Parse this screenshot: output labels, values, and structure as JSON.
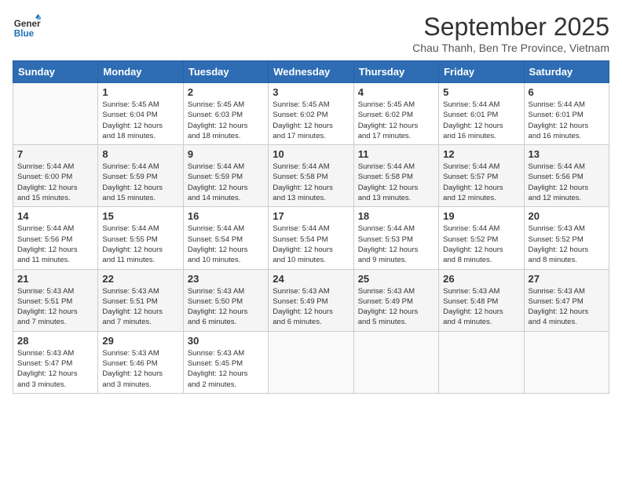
{
  "logo": {
    "general": "General",
    "blue": "Blue"
  },
  "title": "September 2025",
  "location": "Chau Thanh, Ben Tre Province, Vietnam",
  "headers": [
    "Sunday",
    "Monday",
    "Tuesday",
    "Wednesday",
    "Thursday",
    "Friday",
    "Saturday"
  ],
  "weeks": [
    [
      {
        "day": "",
        "info": ""
      },
      {
        "day": "1",
        "info": "Sunrise: 5:45 AM\nSunset: 6:04 PM\nDaylight: 12 hours\nand 18 minutes."
      },
      {
        "day": "2",
        "info": "Sunrise: 5:45 AM\nSunset: 6:03 PM\nDaylight: 12 hours\nand 18 minutes."
      },
      {
        "day": "3",
        "info": "Sunrise: 5:45 AM\nSunset: 6:02 PM\nDaylight: 12 hours\nand 17 minutes."
      },
      {
        "day": "4",
        "info": "Sunrise: 5:45 AM\nSunset: 6:02 PM\nDaylight: 12 hours\nand 17 minutes."
      },
      {
        "day": "5",
        "info": "Sunrise: 5:44 AM\nSunset: 6:01 PM\nDaylight: 12 hours\nand 16 minutes."
      },
      {
        "day": "6",
        "info": "Sunrise: 5:44 AM\nSunset: 6:01 PM\nDaylight: 12 hours\nand 16 minutes."
      }
    ],
    [
      {
        "day": "7",
        "info": "Sunrise: 5:44 AM\nSunset: 6:00 PM\nDaylight: 12 hours\nand 15 minutes."
      },
      {
        "day": "8",
        "info": "Sunrise: 5:44 AM\nSunset: 5:59 PM\nDaylight: 12 hours\nand 15 minutes."
      },
      {
        "day": "9",
        "info": "Sunrise: 5:44 AM\nSunset: 5:59 PM\nDaylight: 12 hours\nand 14 minutes."
      },
      {
        "day": "10",
        "info": "Sunrise: 5:44 AM\nSunset: 5:58 PM\nDaylight: 12 hours\nand 13 minutes."
      },
      {
        "day": "11",
        "info": "Sunrise: 5:44 AM\nSunset: 5:58 PM\nDaylight: 12 hours\nand 13 minutes."
      },
      {
        "day": "12",
        "info": "Sunrise: 5:44 AM\nSunset: 5:57 PM\nDaylight: 12 hours\nand 12 minutes."
      },
      {
        "day": "13",
        "info": "Sunrise: 5:44 AM\nSunset: 5:56 PM\nDaylight: 12 hours\nand 12 minutes."
      }
    ],
    [
      {
        "day": "14",
        "info": "Sunrise: 5:44 AM\nSunset: 5:56 PM\nDaylight: 12 hours\nand 11 minutes."
      },
      {
        "day": "15",
        "info": "Sunrise: 5:44 AM\nSunset: 5:55 PM\nDaylight: 12 hours\nand 11 minutes."
      },
      {
        "day": "16",
        "info": "Sunrise: 5:44 AM\nSunset: 5:54 PM\nDaylight: 12 hours\nand 10 minutes."
      },
      {
        "day": "17",
        "info": "Sunrise: 5:44 AM\nSunset: 5:54 PM\nDaylight: 12 hours\nand 10 minutes."
      },
      {
        "day": "18",
        "info": "Sunrise: 5:44 AM\nSunset: 5:53 PM\nDaylight: 12 hours\nand 9 minutes."
      },
      {
        "day": "19",
        "info": "Sunrise: 5:44 AM\nSunset: 5:52 PM\nDaylight: 12 hours\nand 8 minutes."
      },
      {
        "day": "20",
        "info": "Sunrise: 5:43 AM\nSunset: 5:52 PM\nDaylight: 12 hours\nand 8 minutes."
      }
    ],
    [
      {
        "day": "21",
        "info": "Sunrise: 5:43 AM\nSunset: 5:51 PM\nDaylight: 12 hours\nand 7 minutes."
      },
      {
        "day": "22",
        "info": "Sunrise: 5:43 AM\nSunset: 5:51 PM\nDaylight: 12 hours\nand 7 minutes."
      },
      {
        "day": "23",
        "info": "Sunrise: 5:43 AM\nSunset: 5:50 PM\nDaylight: 12 hours\nand 6 minutes."
      },
      {
        "day": "24",
        "info": "Sunrise: 5:43 AM\nSunset: 5:49 PM\nDaylight: 12 hours\nand 6 minutes."
      },
      {
        "day": "25",
        "info": "Sunrise: 5:43 AM\nSunset: 5:49 PM\nDaylight: 12 hours\nand 5 minutes."
      },
      {
        "day": "26",
        "info": "Sunrise: 5:43 AM\nSunset: 5:48 PM\nDaylight: 12 hours\nand 4 minutes."
      },
      {
        "day": "27",
        "info": "Sunrise: 5:43 AM\nSunset: 5:47 PM\nDaylight: 12 hours\nand 4 minutes."
      }
    ],
    [
      {
        "day": "28",
        "info": "Sunrise: 5:43 AM\nSunset: 5:47 PM\nDaylight: 12 hours\nand 3 minutes."
      },
      {
        "day": "29",
        "info": "Sunrise: 5:43 AM\nSunset: 5:46 PM\nDaylight: 12 hours\nand 3 minutes."
      },
      {
        "day": "30",
        "info": "Sunrise: 5:43 AM\nSunset: 5:45 PM\nDaylight: 12 hours\nand 2 minutes."
      },
      {
        "day": "",
        "info": ""
      },
      {
        "day": "",
        "info": ""
      },
      {
        "day": "",
        "info": ""
      },
      {
        "day": "",
        "info": ""
      }
    ]
  ]
}
